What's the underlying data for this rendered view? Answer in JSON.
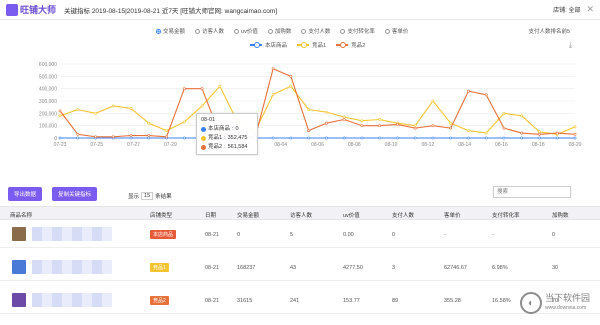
{
  "header": {
    "logo_text": "旺铺大师",
    "title": "关键指标 2019-08-15|2019-08-21 近7天  [旺铺大师官网: wangcaimao.com]",
    "user_label": "店铺: 全部",
    "close_icon": "close-icon"
  },
  "filters": {
    "options": [
      "交易金额",
      "访客人数",
      "uv价值",
      "加购数",
      "支付人数",
      "支付转化率",
      "客单价"
    ],
    "selected_index": 0,
    "export_label": "支付人数排名前5",
    "download_icon": "download-icon"
  },
  "legend": [
    {
      "name": "本店商品",
      "color": "#3b82f6"
    },
    {
      "name": "竞品1",
      "color": "#f4c430"
    },
    {
      "name": "竞品2",
      "color": "#e8703a"
    }
  ],
  "chart_data": {
    "type": "line",
    "x": [
      "07-23",
      "07-25",
      "07-27",
      "07-29",
      "07-31",
      "08-02",
      "08-04",
      "08-06",
      "08-08",
      "08-10",
      "08-12",
      "08-14",
      "08-16",
      "08-18",
      "08-20"
    ],
    "y_ticks": [
      "0",
      "100,000",
      "200,000",
      "300,000",
      "400,000",
      "500,000",
      "600,000"
    ],
    "ylim": [
      0,
      600000
    ],
    "series": [
      {
        "name": "本店商品",
        "color": "#3b82f6",
        "values": [
          0,
          0,
          0,
          0,
          0,
          0,
          0,
          0,
          0,
          0,
          0,
          0,
          0,
          0,
          0,
          0,
          0,
          0,
          0,
          0,
          0,
          0,
          0,
          0,
          0,
          0,
          0,
          0,
          0,
          0
        ]
      },
      {
        "name": "竞品1",
        "color": "#f4c430",
        "values": [
          180000,
          230000,
          200000,
          260000,
          240000,
          120000,
          60000,
          130000,
          260000,
          420000,
          130000,
          60000,
          352475,
          420000,
          230000,
          210000,
          170000,
          140000,
          150000,
          120000,
          100000,
          300000,
          120000,
          60000,
          40000,
          200000,
          180000,
          50000,
          30000,
          90000
        ]
      },
      {
        "name": "竞品2",
        "color": "#e8703a",
        "values": [
          220000,
          30000,
          10000,
          10000,
          20000,
          20000,
          10000,
          400000,
          400000,
          30000,
          10000,
          10000,
          561584,
          500000,
          60000,
          120000,
          150000,
          100000,
          100000,
          110000,
          80000,
          100000,
          80000,
          380000,
          350000,
          80000,
          40000,
          30000,
          40000,
          30000
        ]
      }
    ],
    "tooltip": {
      "date": "08-01",
      "rows": [
        {
          "label": "本店商品",
          "value": "0",
          "color": "#3b82f6"
        },
        {
          "label": "竞品1",
          "value": "352,475",
          "color": "#f4c430"
        },
        {
          "label": "竞品2",
          "value": "561,584",
          "color": "#e8703a"
        }
      ]
    }
  },
  "toolbar": {
    "export_button": "导出数据",
    "copy_button": "复制关键指标",
    "page_size_prefix": "显示",
    "page_size_value": "15",
    "page_size_suffix": "条结果",
    "search_placeholder": "搜索"
  },
  "table": {
    "columns": [
      "商品名称",
      "店铺类型",
      "日期",
      "交易金额",
      "访客人数",
      "uv价值",
      "支付人数",
      "客单价",
      "支付转化率",
      "加购数"
    ],
    "rows": [
      {
        "type": "本店商品",
        "type_color": "#e85b3a",
        "date": "08-21",
        "amount": "0",
        "visitors": "5",
        "uv": "0.00",
        "buyers": "0",
        "price": "-",
        "conversion": "-",
        "cart": "0"
      },
      {
        "type": "竞品1",
        "type_color": "#f4c430",
        "date": "08-21",
        "amount": "168237",
        "visitors": "43",
        "uv": "4277.50",
        "buyers": "3",
        "price": "62746.67",
        "conversion": "6.98%",
        "cart": "30"
      },
      {
        "type": "竞品2",
        "type_color": "#e8703a",
        "date": "08-21",
        "amount": "31615",
        "visitors": "241",
        "uv": "153.77",
        "buyers": "89",
        "price": "355.28",
        "conversion": "16.58%",
        "cart": "70"
      }
    ]
  },
  "watermark": {
    "line1": "当下软件园",
    "line2": "www.downxia.com"
  }
}
